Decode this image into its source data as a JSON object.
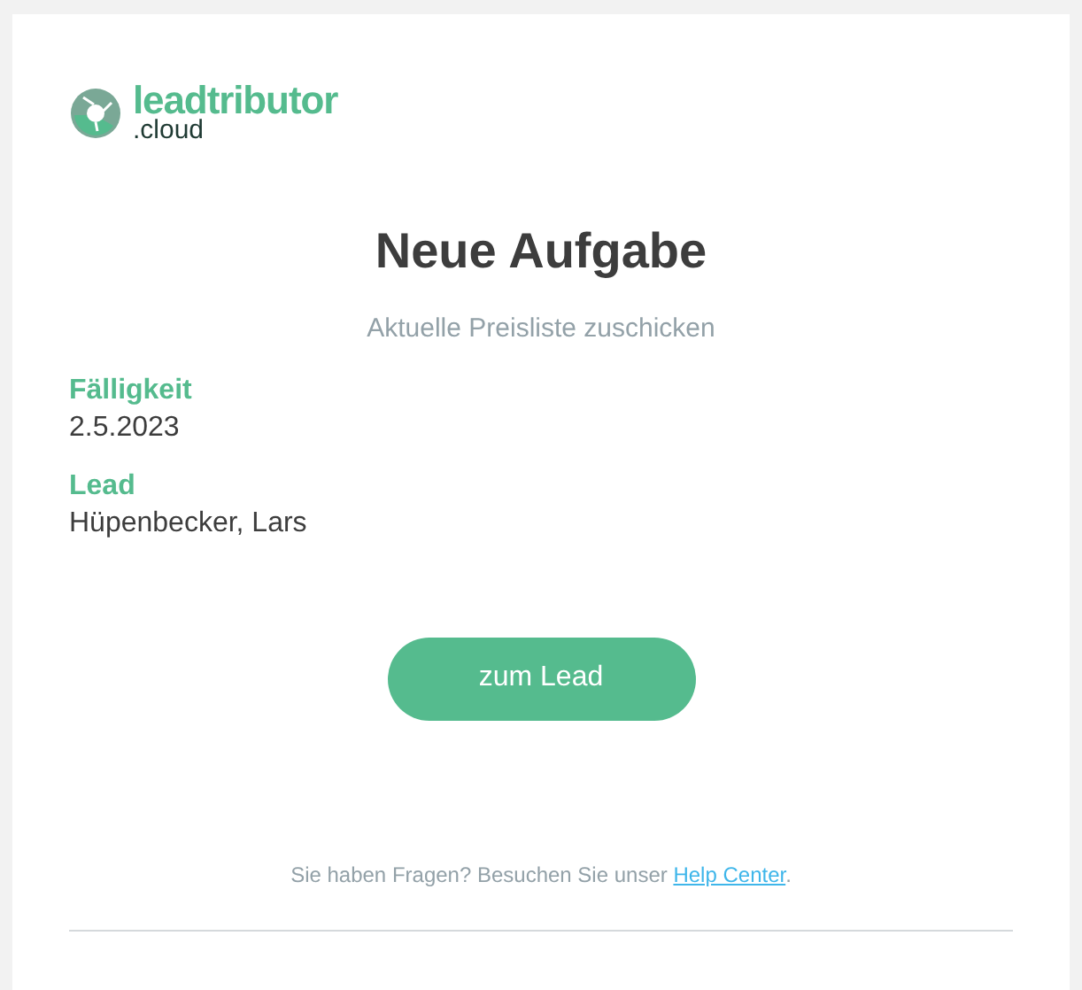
{
  "logo": {
    "name": "leadtributor",
    "suffix": ".cloud"
  },
  "title": "Neue Aufgabe",
  "subtitle": "Aktuelle Preisliste zuschicken",
  "fields": [
    {
      "label": "Fälligkeit",
      "value": "2.5.2023"
    },
    {
      "label": "Lead",
      "value": "Hüpenbecker, Lars"
    }
  ],
  "button": "zum Lead",
  "footer": {
    "text": "Sie haben Fragen? Besuchen Sie unser ",
    "link": "Help Center",
    "after": "."
  }
}
